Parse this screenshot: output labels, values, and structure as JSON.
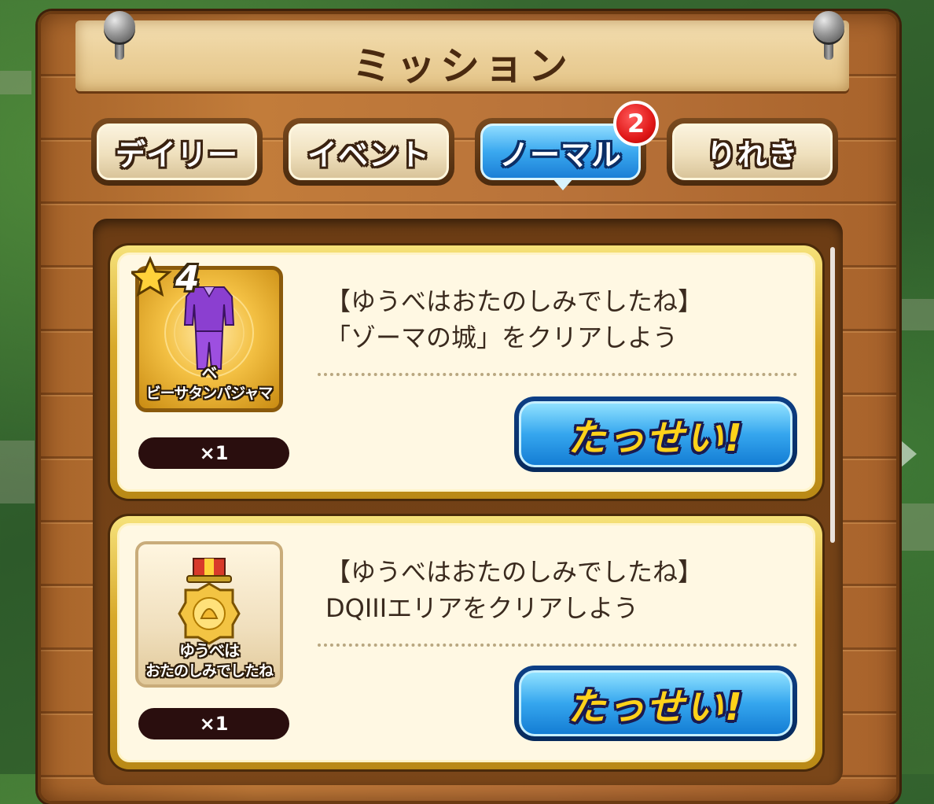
{
  "header": {
    "title": "ミッション"
  },
  "tabs": [
    {
      "label": "デイリー",
      "active": false
    },
    {
      "label": "イベント",
      "active": false
    },
    {
      "label": "ノーマル",
      "active": true,
      "badge": "2"
    },
    {
      "label": "りれき",
      "active": false
    }
  ],
  "missions": [
    {
      "reward": {
        "rarity_stars": "4",
        "name_line1": "ベ",
        "name_line2": "ビーサタンパジャマ",
        "quantity": "×1",
        "icon": "pajama-icon",
        "frame": "gold"
      },
      "title": "【ゆうべはおたのしみでしたね】",
      "description": "「ゾーマの城」をクリアしよう",
      "button_label": "たっせい!"
    },
    {
      "reward": {
        "name_line1": "ゆうべは",
        "name_line2": "おたのしみでしたね",
        "quantity": "×1",
        "icon": "medal-icon",
        "frame": "plain"
      },
      "title": "【ゆうべはおたのしみでしたね】",
      "description": "DQIIIエリアをクリアしよう",
      "button_label": "たっせい!"
    }
  ],
  "colors": {
    "active_tab": "#35a6ee",
    "badge": "#e01818",
    "claim_text": "#ffd21a",
    "board_wood": "#b9733a"
  }
}
